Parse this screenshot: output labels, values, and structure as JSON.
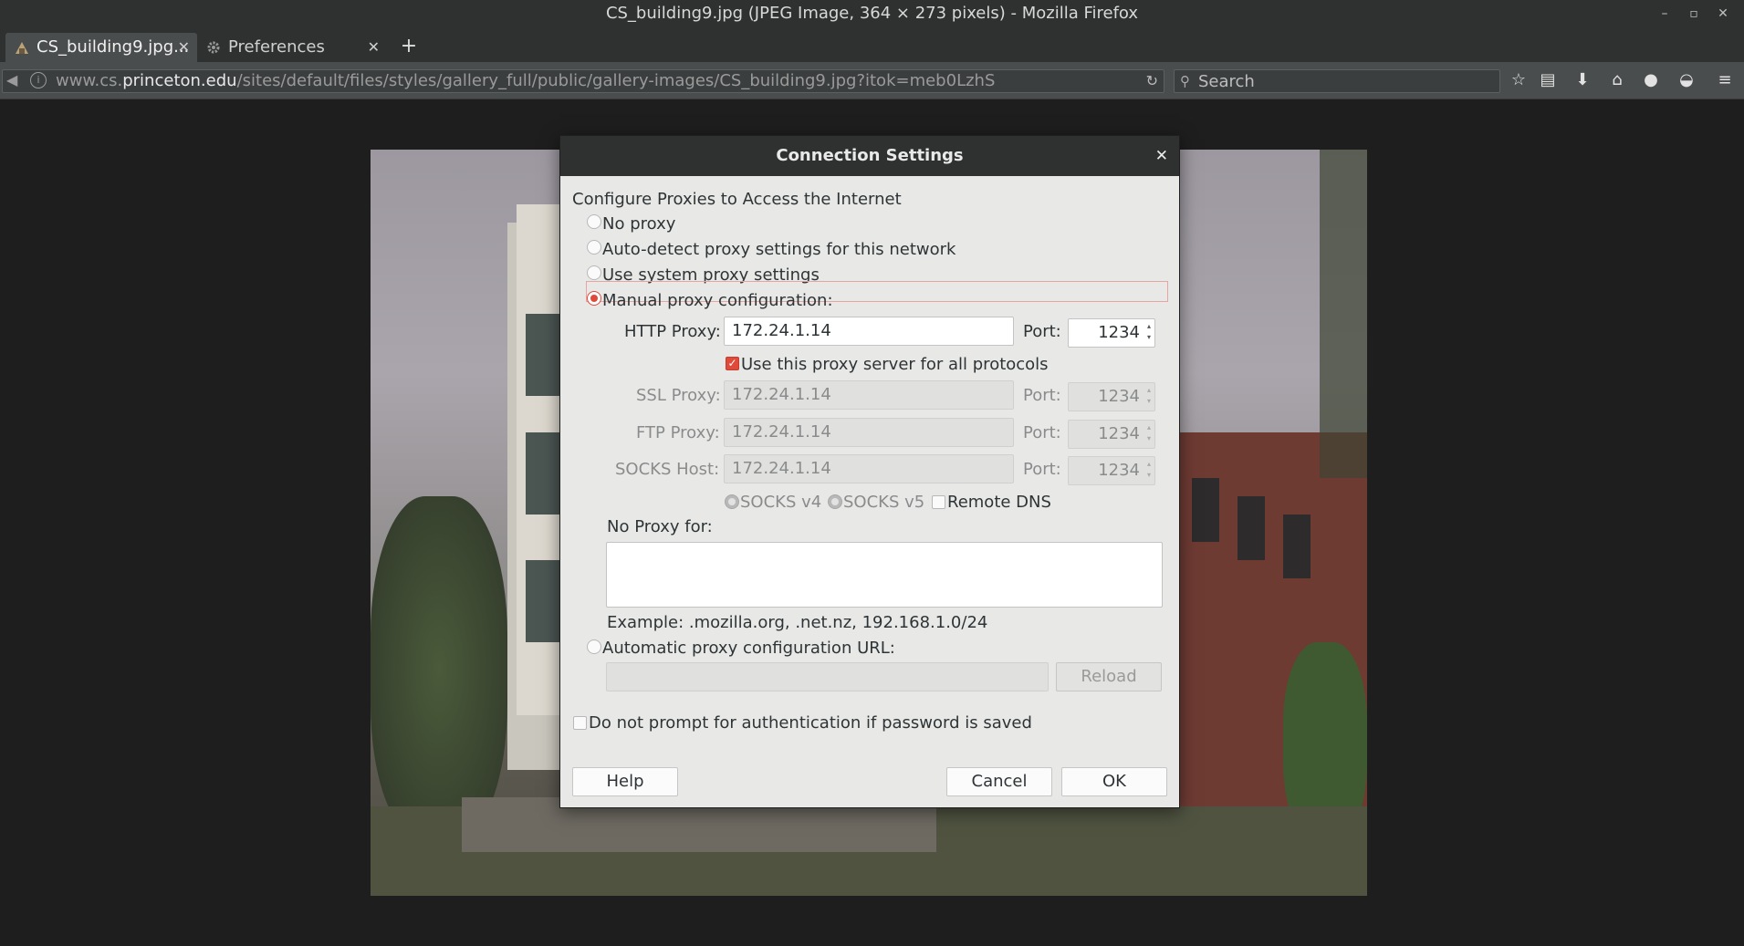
{
  "window": {
    "title": "CS_building9.jpg (JPEG Image, 364 × 273 pixels) - Mozilla Firefox"
  },
  "tabs": [
    {
      "label": "CS_building9.jpg...",
      "active": true
    },
    {
      "label": "Preferences",
      "active": false
    }
  ],
  "toolbar": {
    "url_prefix": "www.cs.",
    "url_host": "princeton.edu",
    "url_path": "/sites/default/files/styles/gallery_full/public/gallery-images/CS_building9.jpg?itok=meb0LzhS",
    "search_placeholder": "Search",
    "icons": [
      "back-icon",
      "info-icon",
      "reload-icon",
      "search-icon",
      "bookmark-star-icon",
      "reading-list-icon",
      "download-icon",
      "home-icon",
      "chat-icon",
      "pocket-icon",
      "menu-icon"
    ]
  },
  "dialog": {
    "title": "Connection Settings",
    "heading": "Configure Proxies to Access the Internet",
    "options": {
      "no_proxy": "No proxy",
      "auto_detect": "Auto-detect proxy settings for this network",
      "system": "Use system proxy settings",
      "manual": "Manual proxy configuration:",
      "pac": "Automatic proxy configuration URL:"
    },
    "selected_option": "manual",
    "http": {
      "label": "HTTP Proxy:",
      "value": "172.24.1.14",
      "port_label": "Port:",
      "port": "1234"
    },
    "use_all": {
      "label": "Use this proxy server for all protocols",
      "checked": true
    },
    "ssl": {
      "label": "SSL Proxy:",
      "value": "172.24.1.14",
      "port_label": "Port:",
      "port": "1234"
    },
    "ftp": {
      "label": "FTP Proxy:",
      "value": "172.24.1.14",
      "port_label": "Port:",
      "port": "1234"
    },
    "socks": {
      "label": "SOCKS Host:",
      "value": "172.24.1.14",
      "port_label": "Port:",
      "port": "1234"
    },
    "socks_v4": "SOCKS v4",
    "socks_v5": "SOCKS v5",
    "remote_dns": {
      "label": "Remote DNS",
      "checked": false
    },
    "no_proxy_for_label": "No Proxy for:",
    "no_proxy_for_value": "",
    "example": "Example: .mozilla.org, .net.nz, 192.168.1.0/24",
    "pac_url": "",
    "reload_button": "Reload",
    "no_prompt": {
      "label": "Do not prompt for authentication if password is saved",
      "checked": false
    },
    "help_button": "Help",
    "cancel_button": "Cancel",
    "ok_button": "OK"
  },
  "colors": {
    "accent": "#e04a3b",
    "titlebar": "#2f3131",
    "dialog_bg": "#e8e8e7"
  }
}
